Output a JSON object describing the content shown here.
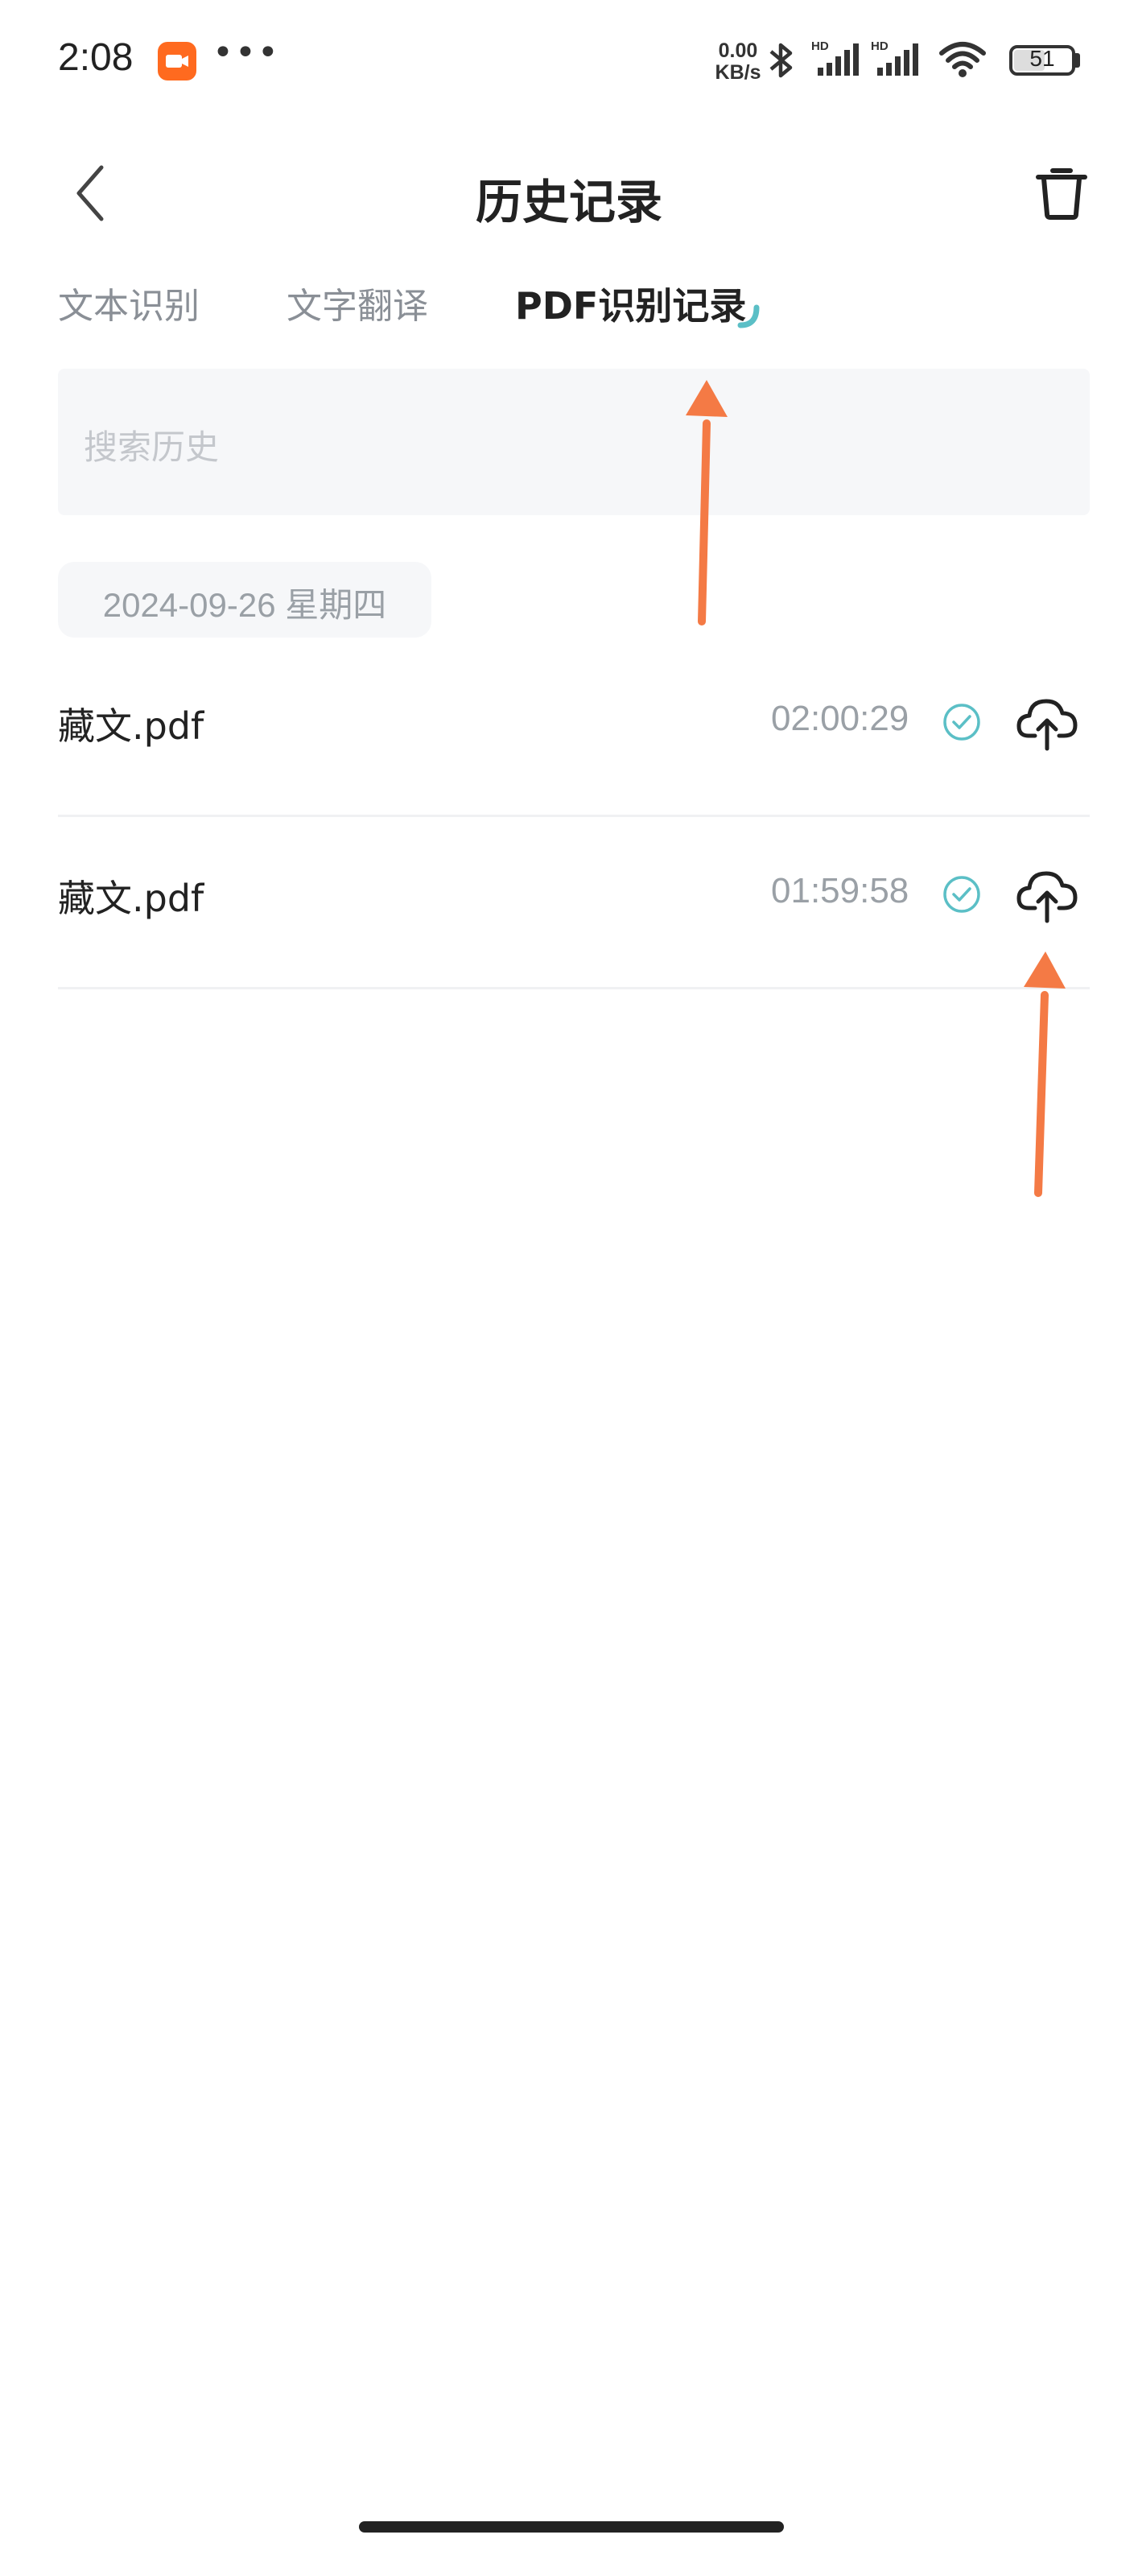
{
  "status_bar": {
    "time": "2:08",
    "net_speed_value": "0.00",
    "net_speed_unit": "KB/s",
    "battery": "51"
  },
  "nav": {
    "title": "历史记录"
  },
  "tabs": [
    {
      "label": "文本识别",
      "active": false
    },
    {
      "label": "文字翻译",
      "active": false
    },
    {
      "label": "PDF识别记录",
      "active": true
    }
  ],
  "search": {
    "placeholder": "搜索历史"
  },
  "groups": [
    {
      "date": "2024-09-26 星期四",
      "items": [
        {
          "name": "藏文.pdf",
          "time": "02:00:29",
          "status": "check-icon",
          "action": "cloud-upload-icon"
        },
        {
          "name": "藏文.pdf",
          "time": "01:59:58",
          "status": "check-icon",
          "action": "cloud-upload-icon"
        }
      ]
    }
  ],
  "colors": {
    "accent": "#5bbfc6",
    "annotation_arrow": "#f47a45",
    "recording": "#ff6a1f"
  }
}
